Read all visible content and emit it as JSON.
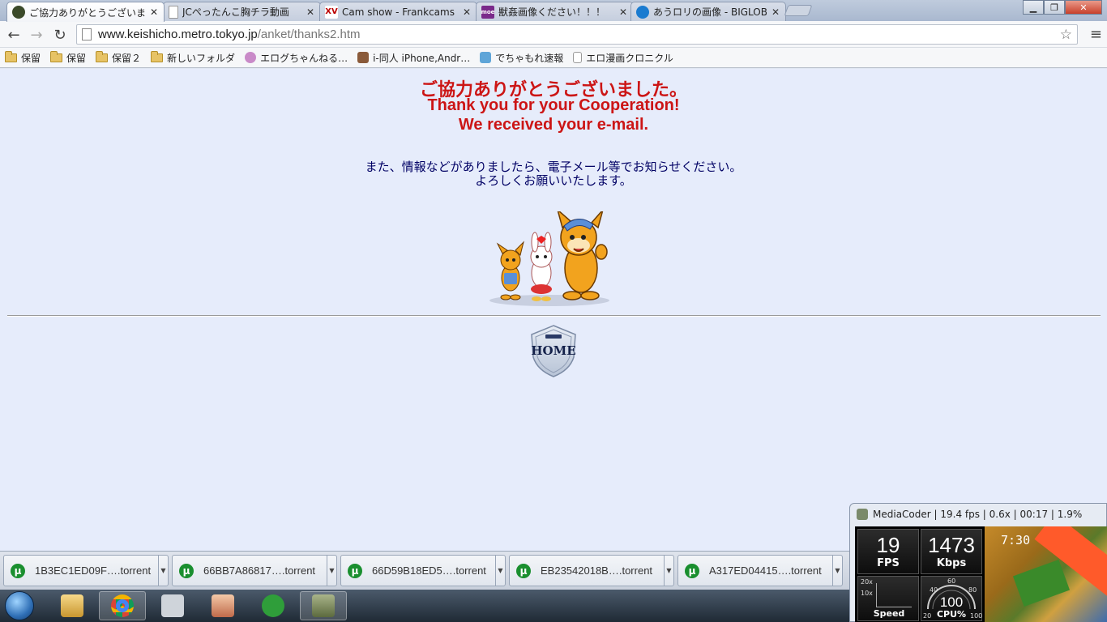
{
  "tabs": [
    {
      "title": "ご協力ありがとうございました",
      "favicon": "police-icon",
      "active": true
    },
    {
      "title": "JCぺったんこ胸チラ動画",
      "favicon": "document-icon",
      "active": false
    },
    {
      "title": "Cam show - Frankcams",
      "favicon": "xv-icon",
      "favicon_text": "XV",
      "active": false
    },
    {
      "title": "獣姦画像ください！！！",
      "favicon": "moe-icon",
      "favicon_text": "moe",
      "active": false
    },
    {
      "title": "あうロリの画像 - BIGLOBE",
      "favicon": "biglobe-icon",
      "active": false
    }
  ],
  "tab_close_glyph": "✕",
  "window_controls": {
    "minimize": "▁",
    "maximize": "❐",
    "close": "✕"
  },
  "toolbar": {
    "back": "←",
    "forward": "→",
    "reload": "↻",
    "url_host": "www.keishicho.metro.tokyo.jp",
    "url_path": "/anket/thanks2.htm",
    "star": "☆",
    "menu": "≡"
  },
  "bookmarks": [
    {
      "label": "保留",
      "icon": "folder-icon"
    },
    {
      "label": "保留",
      "icon": "folder-icon"
    },
    {
      "label": "保留２",
      "icon": "folder-icon"
    },
    {
      "label": "新しいフォルダ",
      "icon": "folder-icon"
    },
    {
      "label": "エログちゃんねる…",
      "icon": "bear-icon"
    },
    {
      "label": "i-同人 iPhone,Andr…",
      "icon": "avatar-icon"
    },
    {
      "label": "でちゃもれ速報",
      "icon": "feather-icon"
    },
    {
      "label": "エロ漫画クロニクル",
      "icon": "document-icon"
    }
  ],
  "page": {
    "heading_jp": "ご協力ありがとうございました。",
    "heading_en_1": "Thank you for your Cooperation!",
    "heading_en_2": "We received your e-mail.",
    "info_1": "また、情報などがありましたら、電子メール等でお知らせください。",
    "info_2": "よろしくお願いいたします。",
    "home_label": "HOME",
    "colors": {
      "heading": "#cc1515",
      "info": "#000064",
      "background": "#e6ecfb"
    }
  },
  "downloads": [
    {
      "name": "1B3EC1ED09F….torrent"
    },
    {
      "name": "66BB7A86817….torrent"
    },
    {
      "name": "66D59B18ED5….torrent"
    },
    {
      "name": "EB23542018B….torrent"
    },
    {
      "name": "A317ED04415….torrent"
    }
  ],
  "taskbar": {
    "apps": [
      "explorer-icon",
      "chrome-icon",
      "j-app-icon",
      "anime-app-icon",
      "utorrent-icon",
      "mediacoder-icon"
    ]
  },
  "mediacoder": {
    "title": "MediaCoder | 19.4 fps | 0.6x | 00:17 | 1.9%",
    "fps_value": "19",
    "fps_label": "FPS",
    "kbps_value": "1473",
    "kbps_label": "Kbps",
    "speed_label": "Speed",
    "speed_ticks": [
      "20x",
      "10x"
    ],
    "cpu_value": "100",
    "cpu_label": "CPU%",
    "cpu_ticks": [
      "60",
      "40",
      "80",
      "20",
      "100"
    ],
    "thumb_text": "7:30"
  }
}
